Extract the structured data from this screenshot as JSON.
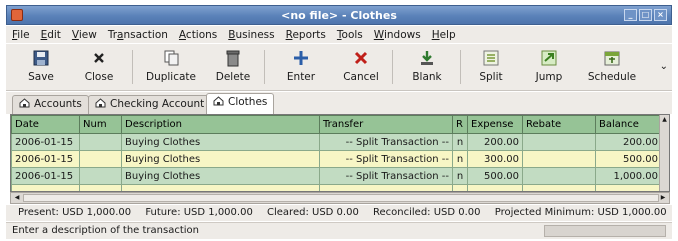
{
  "window": {
    "title": "<no file> - Clothes"
  },
  "menu": [
    {
      "pre": "",
      "ul": "F",
      "post": "ile"
    },
    {
      "pre": "",
      "ul": "E",
      "post": "dit"
    },
    {
      "pre": "",
      "ul": "V",
      "post": "iew"
    },
    {
      "pre": "Tr",
      "ul": "a",
      "post": "nsaction"
    },
    {
      "pre": "",
      "ul": "A",
      "post": "ctions"
    },
    {
      "pre": "",
      "ul": "B",
      "post": "usiness"
    },
    {
      "pre": "",
      "ul": "R",
      "post": "eports"
    },
    {
      "pre": "",
      "ul": "T",
      "post": "ools"
    },
    {
      "pre": "",
      "ul": "W",
      "post": "indows"
    },
    {
      "pre": "",
      "ul": "H",
      "post": "elp"
    }
  ],
  "toolbar": {
    "save": "Save",
    "close": "Close",
    "duplicate": "Duplicate",
    "delete": "Delete",
    "enter": "Enter",
    "cancel": "Cancel",
    "blank": "Blank",
    "split": "Split",
    "jump": "Jump",
    "schedule": "Schedule"
  },
  "tabs": {
    "accounts": "Accounts",
    "checking": "Checking Account",
    "clothes": "Clothes"
  },
  "register": {
    "columns": [
      "Date",
      "Num",
      "Description",
      "Transfer",
      "R",
      "Expense",
      "Rebate",
      "Balance"
    ],
    "rows": [
      {
        "date": "2006-01-15",
        "num": "",
        "description": "Buying Clothes",
        "transfer": "-- Split Transaction --",
        "r": "n",
        "expense": "200.00",
        "rebate": "",
        "balance": "200.00"
      },
      {
        "date": "2006-01-15",
        "num": "",
        "description": "Buying Clothes",
        "transfer": "-- Split Transaction --",
        "r": "n",
        "expense": "300.00",
        "rebate": "",
        "balance": "500.00"
      },
      {
        "date": "2006-01-15",
        "num": "",
        "description": "Buying Clothes",
        "transfer": "-- Split Transaction --",
        "r": "n",
        "expense": "500.00",
        "rebate": "",
        "balance": "1,000.00"
      }
    ]
  },
  "summary": {
    "present": "Present: USD 1,000.00",
    "future": "Future: USD 1,000.00",
    "cleared": "Cleared: USD 0.00",
    "reconciled": "Reconciled: USD 0.00",
    "projected": "Projected Minimum: USD 1,000.00"
  },
  "status": {
    "text": "Enter a description of the transaction"
  },
  "colors": {
    "header": "#96c396",
    "row_green": "#c2dcc2",
    "row_yellow": "#f7f6c5",
    "titlebar": "#5b82b9"
  },
  "icons": [
    "app-icon",
    "save-icon",
    "close-icon",
    "duplicate-icon",
    "delete-icon",
    "enter-icon",
    "cancel-icon",
    "blank-icon",
    "split-icon",
    "jump-icon",
    "schedule-icon",
    "home-icon"
  ]
}
